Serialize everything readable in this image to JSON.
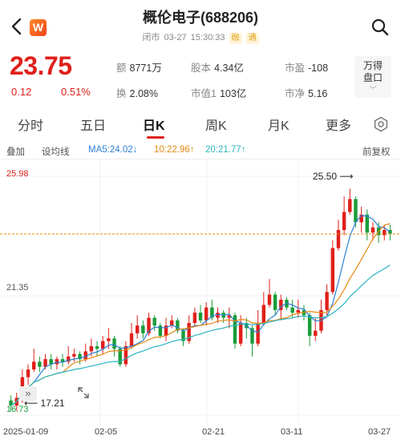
{
  "header": {
    "title": "概伦电子(688206)",
    "status": "闭市",
    "date": "03-27",
    "time": "15:30:33",
    "tag1": "融",
    "tag2": "通",
    "logo_letter": "W"
  },
  "quote": {
    "price": "23.75",
    "change": "0.12",
    "change_pct": "0.51%",
    "price_color": "#e0201b",
    "stats": [
      {
        "key": "额",
        "value": "8771万"
      },
      {
        "key": "股本",
        "value": "4.34亿"
      },
      {
        "key": "市盈",
        "value": "-108"
      },
      {
        "key": "换",
        "value": "2.08%"
      },
      {
        "key": "市值1",
        "value": "103亿"
      },
      {
        "key": "市净",
        "value": "5.16"
      }
    ],
    "wande_line1": "万得",
    "wande_line2": "盘口"
  },
  "tabs": [
    "分时",
    "五日",
    "日K",
    "周K",
    "月K",
    "更多"
  ],
  "active_tab": "日K",
  "indicators": {
    "overlay": "叠加",
    "trendline": "设均线",
    "ma5": "MA5:24.02↓",
    "ma10": "10:22.96↑",
    "ma20": "20:21.77↑",
    "adjust": "前复权"
  },
  "chart_data": {
    "type": "candlestick",
    "y_labels": [
      "25.98",
      "21.35",
      "16.73"
    ],
    "ylim": [
      16.73,
      25.98
    ],
    "x_labels": [
      "2025-01-09",
      "02-05",
      "02-21",
      "03-11",
      "03-27"
    ],
    "high_annotation": "25.50",
    "low_annotation": "17.21",
    "last_price_line": 23.75,
    "candles": [
      [
        17.3,
        17.1,
        17.5,
        16.9
      ],
      [
        17.1,
        17.4,
        17.6,
        16.9
      ],
      [
        17.4,
        18.2,
        18.5,
        17.2
      ],
      [
        18.2,
        18.5,
        18.7,
        17.9
      ],
      [
        18.5,
        18.8,
        19.3,
        18.4
      ],
      [
        18.8,
        18.6,
        19.0,
        18.4
      ],
      [
        18.6,
        18.9,
        19.1,
        18.5
      ],
      [
        18.9,
        18.7,
        19.1,
        18.5
      ],
      [
        18.7,
        18.9,
        19.0,
        18.5
      ],
      [
        18.9,
        18.8,
        19.1,
        18.6
      ],
      [
        18.8,
        19.0,
        19.4,
        18.7
      ],
      [
        19.0,
        19.1,
        19.3,
        18.8
      ],
      [
        19.1,
        18.9,
        19.2,
        18.7
      ],
      [
        18.9,
        19.2,
        19.5,
        18.8
      ],
      [
        19.2,
        19.4,
        19.7,
        19.0
      ],
      [
        19.4,
        19.3,
        19.6,
        19.0
      ],
      [
        19.3,
        19.6,
        19.8,
        19.1
      ],
      [
        19.6,
        19.7,
        20.1,
        19.3
      ],
      [
        19.7,
        19.3,
        19.8,
        19.0
      ],
      [
        19.3,
        18.7,
        19.4,
        18.6
      ],
      [
        18.7,
        19.4,
        19.6,
        18.6
      ],
      [
        19.4,
        19.9,
        20.3,
        19.3
      ],
      [
        19.9,
        20.2,
        20.6,
        19.7
      ],
      [
        20.2,
        19.9,
        20.4,
        19.7
      ],
      [
        19.9,
        20.5,
        20.7,
        19.8
      ],
      [
        20.5,
        20.2,
        20.6,
        20.0
      ],
      [
        20.2,
        19.8,
        20.3,
        19.7
      ],
      [
        19.8,
        20.2,
        20.5,
        19.6
      ],
      [
        20.2,
        20.4,
        20.6,
        20.1
      ],
      [
        20.4,
        20.0,
        20.5,
        19.9
      ],
      [
        20.0,
        19.6,
        20.1,
        19.4
      ],
      [
        19.6,
        20.3,
        20.6,
        19.5
      ],
      [
        20.3,
        20.7,
        20.9,
        20.2
      ],
      [
        20.7,
        20.4,
        21.0,
        20.3
      ],
      [
        20.4,
        20.9,
        21.1,
        20.2
      ],
      [
        20.9,
        20.5,
        21.2,
        20.4
      ],
      [
        20.5,
        20.7,
        20.9,
        20.3
      ],
      [
        20.7,
        20.5,
        20.8,
        20.3
      ],
      [
        20.5,
        20.6,
        20.9,
        20.1
      ],
      [
        20.6,
        19.5,
        20.7,
        19.3
      ],
      [
        19.5,
        20.3,
        20.6,
        19.4
      ],
      [
        20.3,
        20.1,
        20.5,
        19.7
      ],
      [
        20.1,
        19.5,
        20.2,
        19.0
      ],
      [
        19.5,
        20.3,
        20.8,
        19.4
      ],
      [
        20.3,
        21.0,
        21.5,
        20.2
      ],
      [
        21.0,
        21.4,
        22.0,
        20.9
      ],
      [
        21.4,
        20.8,
        21.5,
        20.6
      ],
      [
        20.8,
        21.2,
        21.4,
        20.4
      ],
      [
        21.2,
        20.9,
        21.3,
        20.8
      ],
      [
        20.9,
        20.7,
        21.2,
        20.5
      ],
      [
        20.7,
        20.8,
        21.2,
        20.5
      ],
      [
        20.8,
        20.6,
        21.0,
        20.4
      ],
      [
        20.6,
        19.8,
        20.7,
        19.4
      ],
      [
        19.8,
        20.0,
        20.5,
        19.6
      ],
      [
        20.0,
        20.8,
        21.2,
        19.9
      ],
      [
        20.8,
        21.5,
        21.8,
        20.6
      ],
      [
        21.5,
        23.2,
        23.5,
        21.4
      ],
      [
        23.2,
        23.9,
        24.3,
        23.1
      ],
      [
        23.9,
        24.6,
        25.2,
        23.7
      ],
      [
        24.6,
        25.1,
        25.5,
        24.5
      ],
      [
        25.1,
        24.2,
        25.2,
        24.0
      ],
      [
        24.2,
        24.5,
        24.8,
        23.8
      ],
      [
        24.5,
        23.8,
        24.7,
        23.5
      ],
      [
        23.8,
        24.0,
        24.2,
        23.5
      ],
      [
        24.0,
        23.7,
        24.2,
        23.4
      ],
      [
        23.7,
        23.9,
        24.1,
        23.5
      ],
      [
        23.9,
        23.75,
        24.1,
        23.5
      ]
    ]
  }
}
